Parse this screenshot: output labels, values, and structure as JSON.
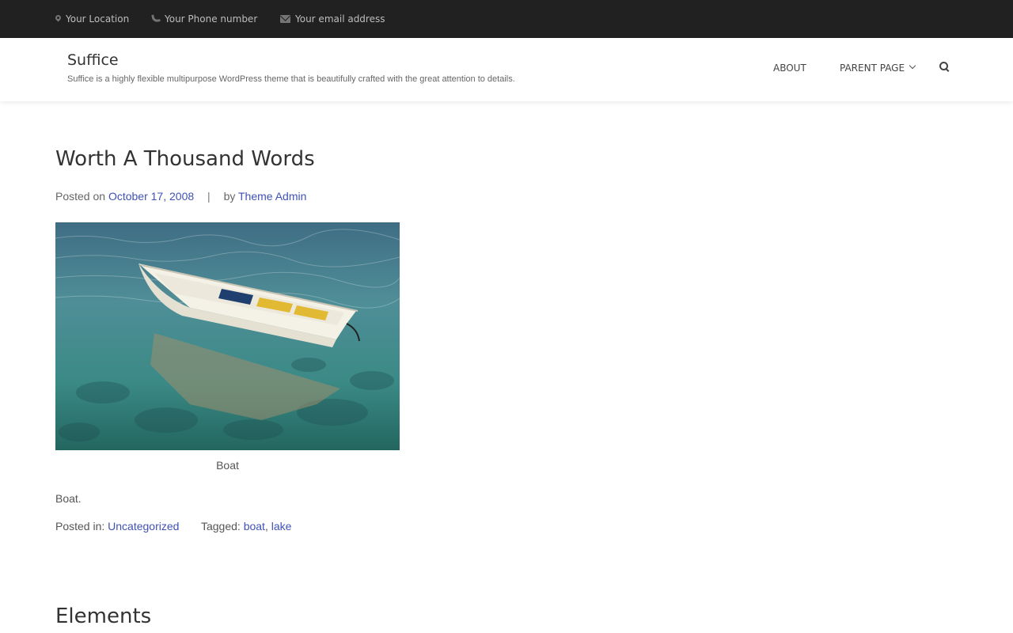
{
  "topbar": {
    "location": "Your Location",
    "phone": "Your Phone number",
    "email": "Your email address"
  },
  "header": {
    "site_title": "Suffice",
    "site_description": "Suffice is a highly flexible multipurpose WordPress theme that is beautifully crafted with the great attention to details.",
    "nav": {
      "about": "ABOUT",
      "parent_page": "PARENT PAGE"
    }
  },
  "post": {
    "title": "Worth A Thousand Words",
    "posted_on_label": "Posted on",
    "date": "October 17, 2008",
    "separator": "|",
    "by_label": "by",
    "author": "Theme Admin",
    "image_caption": "Boat",
    "body": "Boat.",
    "posted_in_label": "Posted in:",
    "category": "Uncategorized",
    "tagged_label": "Tagged:",
    "tags": [
      "boat",
      "lake"
    ],
    "tag_separator": ","
  },
  "next_post": {
    "title": "Elements"
  },
  "colors": {
    "topbar_bg": "#212121",
    "link": "#3f51b5",
    "title": "#333333"
  }
}
